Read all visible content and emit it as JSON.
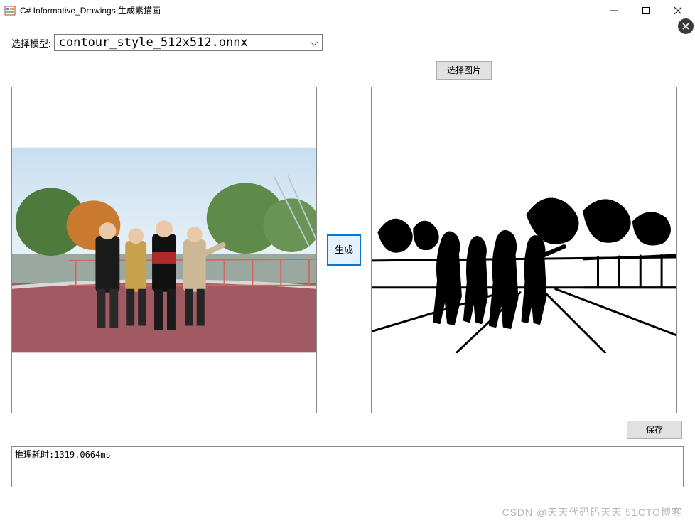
{
  "window": {
    "title": "C# Informative_Drawings 生成素描画"
  },
  "labels": {
    "select_model": "选择模型:"
  },
  "combo": {
    "selected": "contour_style_512x512.onnx"
  },
  "buttons": {
    "select_image": "选择图片",
    "generate": "生成",
    "save": "保存"
  },
  "log": {
    "text": "推理耗时:1319.0664ms"
  },
  "watermark": "CSDN @天天代码码天天  51CTO博客"
}
